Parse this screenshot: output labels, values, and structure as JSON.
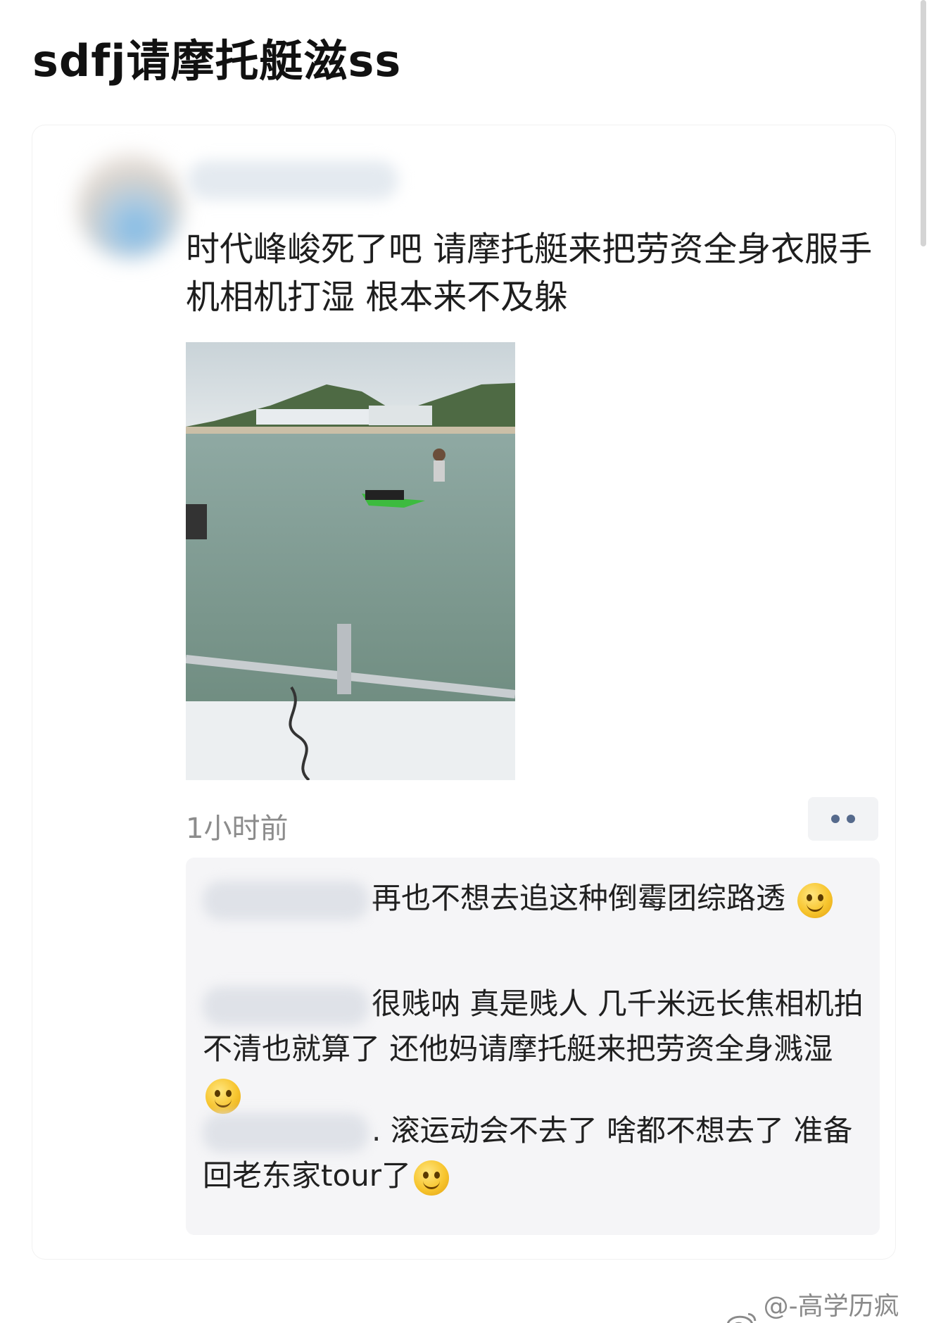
{
  "header": {
    "title": "sdfj请摩托艇滋ss"
  },
  "post": {
    "text": "时代峰峻死了吧 请摩托艇来把劳资全身衣服手机相机打湿 根本来不及躲",
    "time": "1小时前"
  },
  "comments": [
    {
      "text": "再也不想去追这种倒霉团综路透",
      "emoji": "smile-emoji"
    },
    {
      "text": "很贱呐 真是贱人 几千米远长焦相机拍不清也就算了 还他妈请摩托艇来把劳资全身溅湿",
      "emoji": "smile-emoji"
    },
    {
      "text": ". 滚运动会不去了 啥都不想去了 准备回老东家tour了",
      "emoji": "smile-emoji"
    }
  ],
  "watermark": {
    "text": "@-高学历疯批-"
  },
  "colors": {
    "accent_dots": "#566a8c",
    "comment_bg": "#f5f5f7",
    "time_text": "#8c8c8c"
  }
}
